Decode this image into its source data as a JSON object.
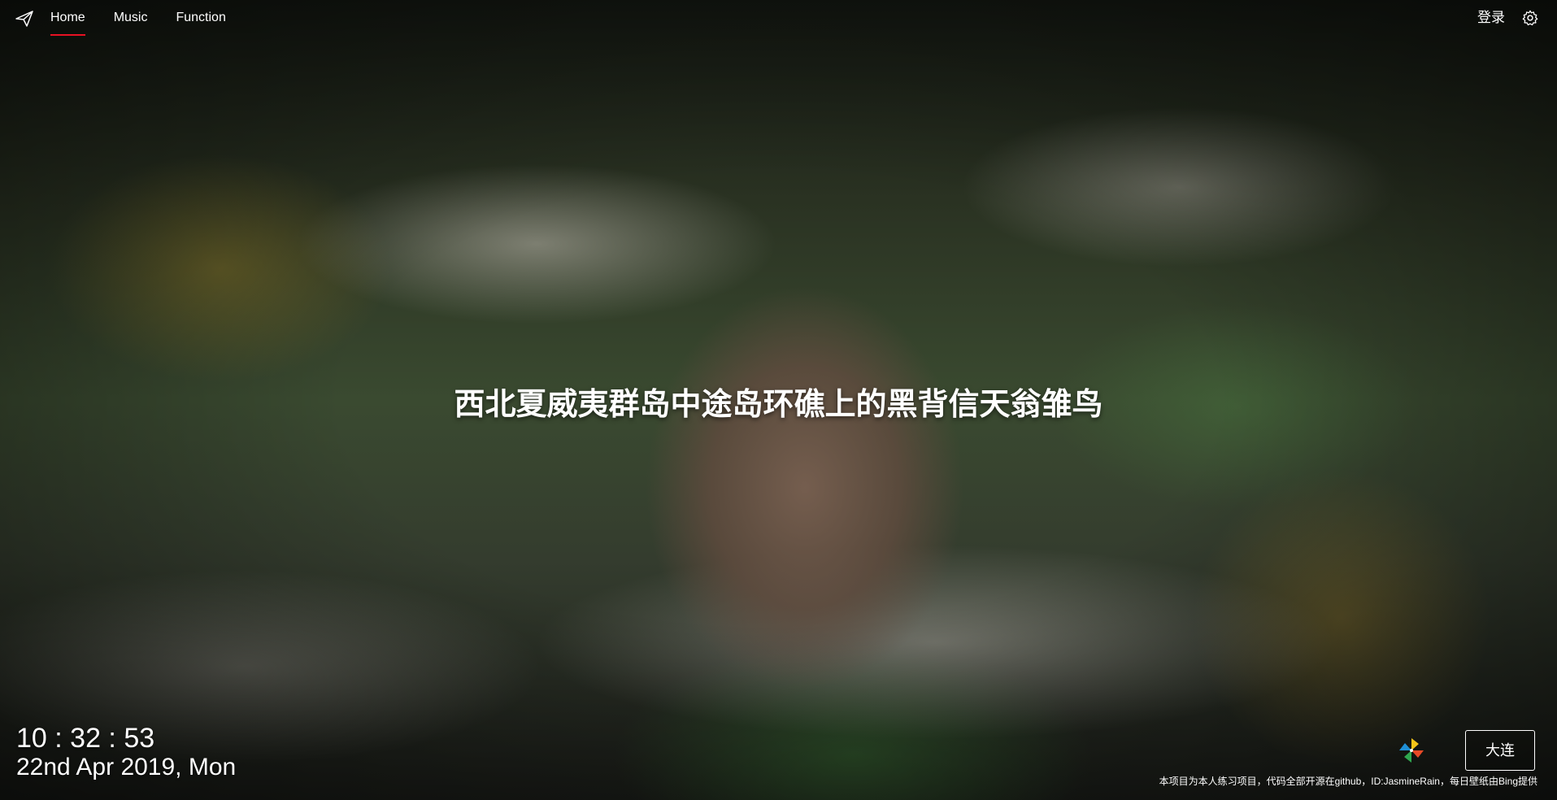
{
  "header": {
    "logo_icon": "paper-plane-icon",
    "nav": [
      {
        "label": "Home",
        "active": true
      },
      {
        "label": "Music",
        "active": false
      },
      {
        "label": "Function",
        "active": false
      }
    ],
    "login_label": "登录",
    "settings_icon": "gear-icon",
    "accent_color": "#e81123"
  },
  "wallpaper": {
    "caption": "西北夏威夷群岛中途岛环礁上的黑背信天翁雏鸟"
  },
  "clock": {
    "time": "10 : 32 : 53",
    "date": "22nd Apr 2019, Mon"
  },
  "weather": {
    "icon": "pinwheel-icon",
    "city": "大连"
  },
  "footer": {
    "text": "本项目为本人练习项目，代码全部开源在github，ID:JasmineRain，每日壁纸由Bing提供"
  }
}
